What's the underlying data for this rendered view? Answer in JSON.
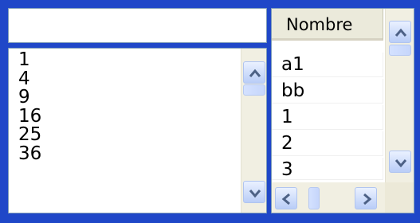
{
  "text_input": {
    "value": ""
  },
  "listbox": {
    "items": [
      "1",
      "4",
      "9",
      "16",
      "25",
      "36"
    ]
  },
  "grid": {
    "header": "Nombre",
    "rows": [
      "a1",
      "bb",
      "1",
      "2",
      "3"
    ]
  },
  "colors": {
    "frame": "#1f47c8",
    "scroll_button": "#c6d6fb",
    "arrow": "#4d6185"
  }
}
